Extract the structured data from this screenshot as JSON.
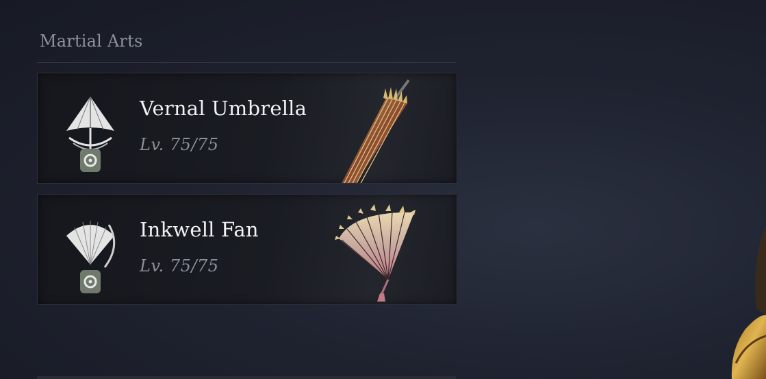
{
  "section": {
    "title": "Martial Arts"
  },
  "weapons": [
    {
      "name": "Vernal Umbrella",
      "level": "Lv. 75/75",
      "icon": "umbrella-icon"
    },
    {
      "name": "Inkwell Fan",
      "level": "Lv. 75/75",
      "icon": "fan-icon"
    }
  ],
  "colors": {
    "background": "#1f2330",
    "card": "#1a1c23",
    "title": "#8e929c",
    "name": "#f2f2f4",
    "level": "#8c8f98",
    "badge": "#e8e8e8",
    "badge_seal": "#6f7a6c"
  }
}
